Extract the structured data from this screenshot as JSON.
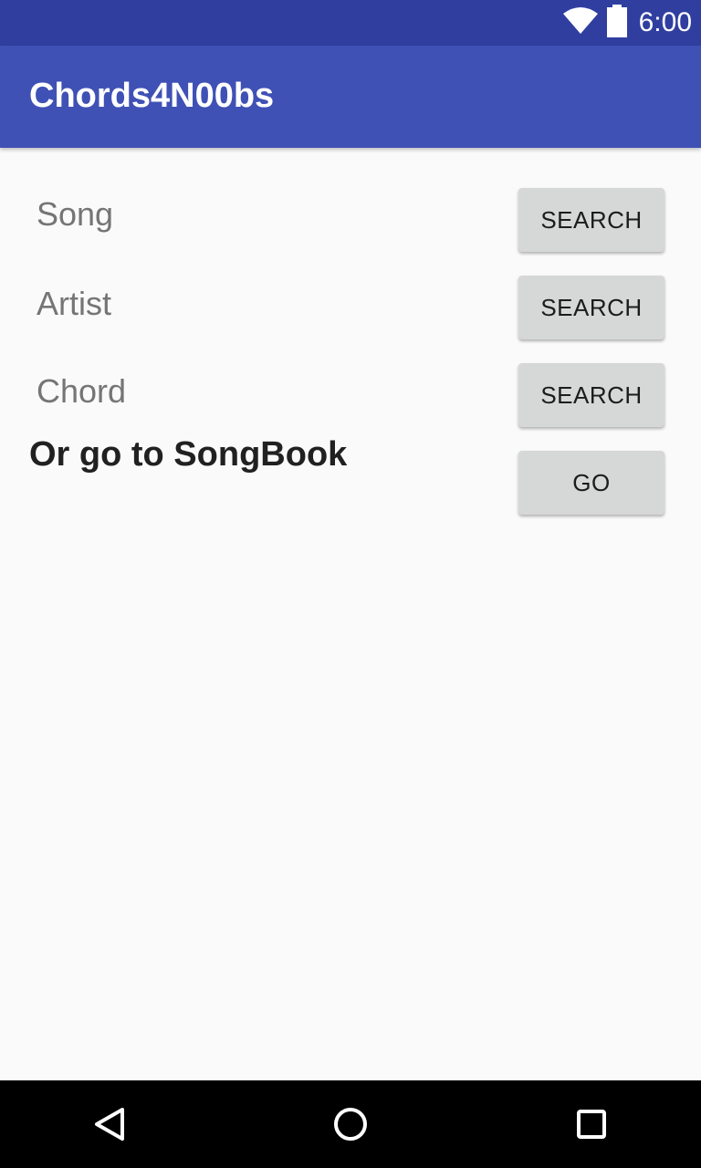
{
  "status_bar": {
    "time": "6:00",
    "icons": [
      "wifi-icon",
      "battery-icon"
    ]
  },
  "app_bar": {
    "title": "Chords4N00bs"
  },
  "search": {
    "fields": [
      {
        "label": "Song",
        "button_label": "SEARCH"
      },
      {
        "label": "Artist",
        "button_label": "SEARCH"
      },
      {
        "label": "Chord",
        "button_label": "SEARCH"
      }
    ],
    "songbook_text": "Or go to SongBook",
    "go_label": "GO"
  },
  "nav_bar": {
    "icons": [
      "back-icon",
      "home-icon",
      "recents-icon"
    ]
  },
  "colors": {
    "status_bar": "#303f9f",
    "app_bar": "#3f51b5",
    "background": "#fafafa",
    "button": "#d6d7d7"
  }
}
